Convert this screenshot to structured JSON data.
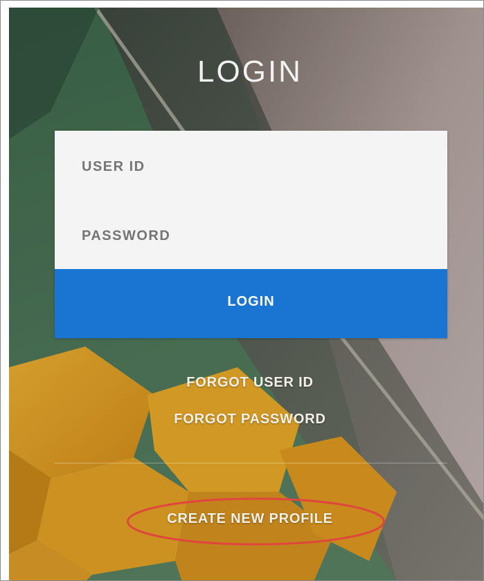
{
  "login_form": {
    "title": "LOGIN",
    "user_id_placeholder": "USER ID",
    "password_placeholder": "PASSWORD",
    "login_button_label": "LOGIN"
  },
  "links": {
    "forgot_user_id": "FORGOT USER ID",
    "forgot_password": "FORGOT PASSWORD",
    "create_new_profile": "CREATE NEW PROFILE"
  },
  "colors": {
    "accent": "#1a74d2",
    "highlight_ring": "#e0463e"
  }
}
